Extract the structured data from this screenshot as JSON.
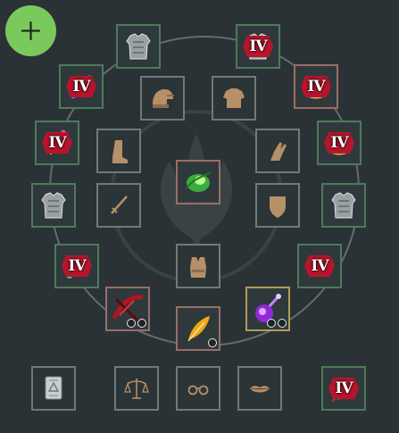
{
  "colors": {
    "background": "#2a3236",
    "add_button": "#7bc95c",
    "tier_badge": "#b8152c"
  },
  "add_button": {
    "icon": "plus-icon"
  },
  "tier_label": "IV",
  "slots": [
    {
      "name": "chest-armor-top-left",
      "icon": "chest-armor-icon",
      "tier": "",
      "sockets": 0
    },
    {
      "name": "chest-armor-top-right",
      "icon": "chest-armor-icon",
      "tier": "IV",
      "sockets": 0
    },
    {
      "name": "necklace-left",
      "icon": "necklace-icon",
      "tier": "IV",
      "sockets": 0
    },
    {
      "name": "ring-right-upper",
      "icon": "ring-icon",
      "tier": "IV",
      "sockets": 0
    },
    {
      "name": "helmet-slot",
      "icon": "helmet-icon",
      "tier": "",
      "sockets": 0
    },
    {
      "name": "shirt-slot",
      "icon": "shirt-icon",
      "tier": "",
      "sockets": 0
    },
    {
      "name": "earring-left",
      "icon": "earring-icon",
      "tier": "IV",
      "sockets": 0
    },
    {
      "name": "ring-right-lower",
      "icon": "ring-icon",
      "tier": "IV",
      "sockets": 0
    },
    {
      "name": "boots-slot",
      "icon": "boots-icon",
      "tier": "",
      "sockets": 0
    },
    {
      "name": "gloves-slot",
      "icon": "gloves-icon",
      "tier": "",
      "sockets": 0
    },
    {
      "name": "soul-crystal-slot",
      "icon": "soul-crystal-icon",
      "tier": "",
      "sockets": 0
    },
    {
      "name": "armor-left",
      "icon": "chest-armor-icon",
      "tier": "",
      "sockets": 0
    },
    {
      "name": "sword-slot",
      "icon": "sword-icon",
      "tier": "",
      "sockets": 0
    },
    {
      "name": "shield-slot",
      "icon": "shield-icon",
      "tier": "",
      "sockets": 0
    },
    {
      "name": "armor-right",
      "icon": "chest-armor-icon",
      "tier": "",
      "sockets": 0
    },
    {
      "name": "bracer-left",
      "icon": "bracer-icon",
      "tier": "IV",
      "sockets": 0
    },
    {
      "name": "belt-right",
      "icon": "belt-icon",
      "tier": "IV",
      "sockets": 0
    },
    {
      "name": "vest-slot",
      "icon": "vest-icon",
      "tier": "",
      "sockets": 0
    },
    {
      "name": "crossbow-slot",
      "icon": "crossbow-icon",
      "tier": "",
      "sockets": 2
    },
    {
      "name": "potion-slot",
      "icon": "potion-icon",
      "tier": "",
      "sockets": 2
    },
    {
      "name": "feather-slot",
      "icon": "feather-icon",
      "tier": "",
      "sockets": 1
    },
    {
      "name": "book-slot",
      "icon": "book-icon",
      "tier": "",
      "sockets": 0
    },
    {
      "name": "scale-slot",
      "icon": "scale-icon",
      "tier": "",
      "sockets": 0
    },
    {
      "name": "glasses-slot",
      "icon": "glasses-icon",
      "tier": "",
      "sockets": 0
    },
    {
      "name": "lips-slot",
      "icon": "lips-icon",
      "tier": "",
      "sockets": 0
    },
    {
      "name": "dagger-slot",
      "icon": "dagger-icon",
      "tier": "IV",
      "sockets": 0
    }
  ]
}
